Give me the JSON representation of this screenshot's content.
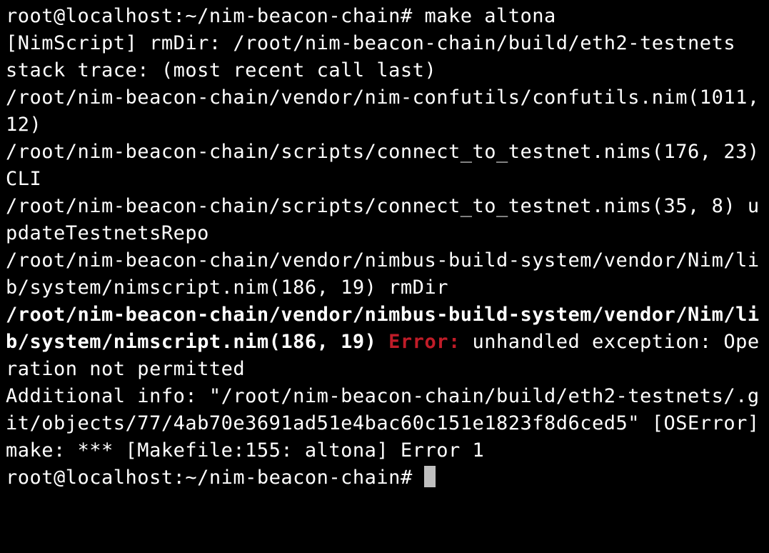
{
  "prompt1_user": "root@localhost",
  "prompt1_sep": ":",
  "prompt1_path": "~/nim-beacon-chain",
  "prompt1_hash": "# ",
  "command1": "make altona",
  "line_rmdir": "[NimScript] rmDir: /root/nim-beacon-chain/build/eth2-testnets",
  "line_stacktrace": "stack trace: (most recent call last)",
  "line_trace1": "/root/nim-beacon-chain/vendor/nim-confutils/confutils.nim(1011, 12) ",
  "line_trace2": "/root/nim-beacon-chain/scripts/connect_to_testnet.nims(176, 23) CLI",
  "line_trace3": "/root/nim-beacon-chain/scripts/connect_to_testnet.nims(35, 8) updateTestnetsRepo",
  "line_trace4": "/root/nim-beacon-chain/vendor/nimbus-build-system/vendor/Nim/lib/system/nimscript.nim(186, 19) rmDir",
  "line_error_path_bold": "/root/nim-beacon-chain/vendor/nimbus-build-system/vendor/Nim/lib/system/nimscript.nim(186, 19) ",
  "line_error_label": "Error:",
  "line_error_rest": " unhandled exception: Operation not permitted",
  "line_additional": "Additional info: \"/root/nim-beacon-chain/build/eth2-testnets/.git/objects/77/4ab70e3691ad51e4bac60c151e1823f8d6ced5\" [OSError]",
  "line_make": "make: *** [Makefile:155: altona] Error 1",
  "prompt2_user": "root@localhost",
  "prompt2_sep": ":",
  "prompt2_path": "~/nim-beacon-chain",
  "prompt2_hash": "# "
}
